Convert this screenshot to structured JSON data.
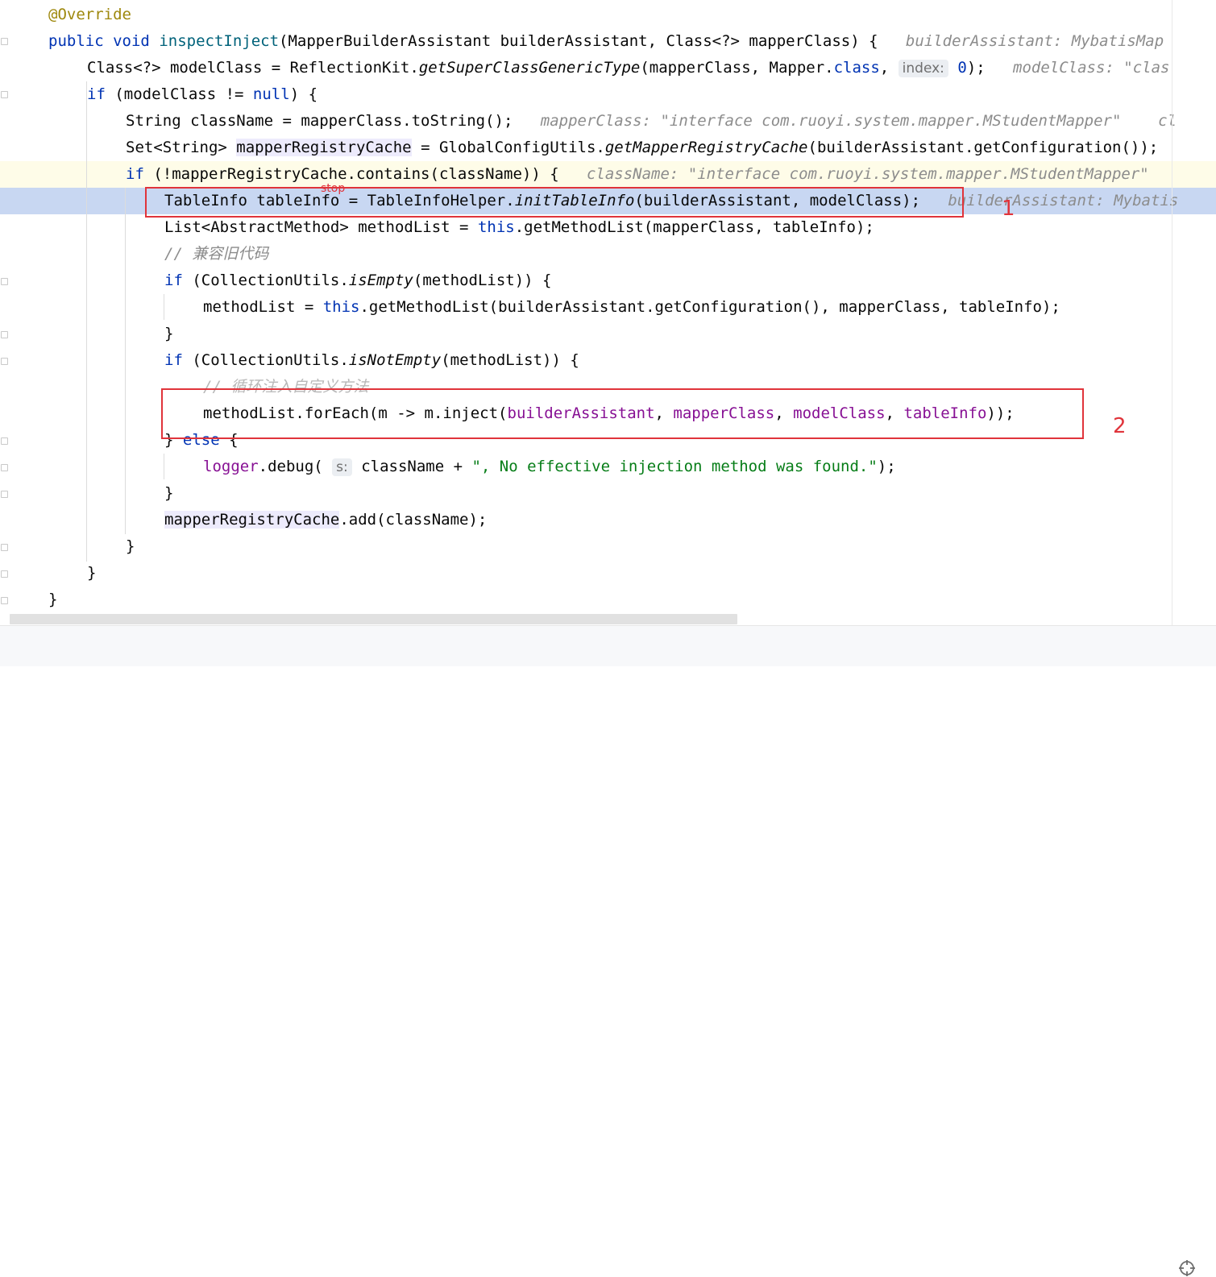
{
  "lines": [
    {
      "segs": [
        {
          "c": "ann",
          "t": "@Override"
        }
      ]
    },
    {
      "segs": [
        {
          "c": "kw",
          "t": "public"
        },
        {
          "t": " "
        },
        {
          "c": "kw",
          "t": "void"
        },
        {
          "t": " "
        },
        {
          "c": "fn",
          "t": "inspectInject"
        },
        {
          "t": "(MapperBuilderAssistant builderAssistant, Class<?> mapperClass) {   "
        },
        {
          "c": "hint",
          "t": "builderAssistant: MybatisMap"
        }
      ]
    },
    {
      "segs": [
        {
          "t": "Class<?> modelClass = ReflectionKit."
        },
        {
          "c": "it",
          "t": "getSuperClassGenericType"
        },
        {
          "t": "(mapperClass, Mapper."
        },
        {
          "c": "kw",
          "t": "class"
        },
        {
          "t": ", "
        },
        {
          "c": "ph",
          "t": "index:"
        },
        {
          "t": " "
        },
        {
          "c": "kw",
          "t": "0"
        },
        {
          "t": ");   "
        },
        {
          "c": "hint",
          "t": "modelClass: \"clas"
        }
      ]
    },
    {
      "segs": [
        {
          "c": "kw",
          "t": "if"
        },
        {
          "t": " (modelClass != "
        },
        {
          "c": "kw",
          "t": "null"
        },
        {
          "t": ") {"
        }
      ]
    },
    {
      "segs": [
        {
          "t": "String className = mapperClass.toString();   "
        },
        {
          "c": "hint",
          "t": "mapperClass: \"interface com.ruoyi.system.mapper.MStudentMapper\"    cl"
        }
      ]
    },
    {
      "segs": [
        {
          "t": "Set<String> "
        },
        {
          "c": "hl",
          "t": "mapperRegistryCache"
        },
        {
          "t": " = GlobalConfigUtils."
        },
        {
          "c": "it",
          "t": "getMapperRegistryCache"
        },
        {
          "t": "(builderAssistant.getConfiguration());"
        }
      ]
    },
    {
      "segs": [
        {
          "c": "kw",
          "t": "if"
        },
        {
          "t": " (!mapperRegistryCache.contains(className)) {   "
        },
        {
          "c": "hint",
          "t": "className: \"interface com.ruoyi.system.mapper.MStudentMapper\""
        }
      ]
    },
    {
      "segs": [
        {
          "t": "TableInfo tableInfo = TableInfoHelper."
        },
        {
          "c": "it",
          "t": "initTableInfo"
        },
        {
          "t": "(builderAssistant, modelClass);   "
        },
        {
          "c": "hint",
          "t": "builderAssistant: Mybatis"
        }
      ]
    },
    {
      "segs": [
        {
          "t": "List<AbstractMethod> methodList = "
        },
        {
          "c": "kw",
          "t": "this"
        },
        {
          "t": ".getMethodList(mapperClass, tableInfo);"
        }
      ]
    },
    {
      "segs": [
        {
          "c": "cm",
          "t": "// 兼容旧代码"
        }
      ]
    },
    {
      "segs": [
        {
          "c": "kw",
          "t": "if"
        },
        {
          "t": " (CollectionUtils."
        },
        {
          "c": "it",
          "t": "isEmpty"
        },
        {
          "t": "(methodList)) {"
        }
      ]
    },
    {
      "segs": [
        {
          "t": "methodList = "
        },
        {
          "c": "kw",
          "t": "this"
        },
        {
          "t": ".getMethodList(builderAssistant.getConfiguration(), mapperClass, tableInfo);"
        }
      ]
    },
    {
      "segs": [
        {
          "t": "}"
        }
      ]
    },
    {
      "segs": [
        {
          "c": "kw",
          "t": "if"
        },
        {
          "t": " (CollectionUtils."
        },
        {
          "c": "it",
          "t": "isNotEmpty"
        },
        {
          "t": "(methodList)) {"
        }
      ]
    },
    {
      "segs": [
        {
          "c": "cmx",
          "t": "// 循环注入自定义方法"
        }
      ]
    },
    {
      "segs": [
        {
          "t": "methodList.forEach(m -> m.inject("
        },
        {
          "c": "pu",
          "t": "builderAssistant"
        },
        {
          "t": ", "
        },
        {
          "c": "pu",
          "t": "mapperClass"
        },
        {
          "t": ", "
        },
        {
          "c": "pu",
          "t": "modelClass"
        },
        {
          "t": ", "
        },
        {
          "c": "pu",
          "t": "tableInfo"
        },
        {
          "t": "));"
        }
      ]
    },
    {
      "segs": [
        {
          "t": "} "
        },
        {
          "c": "kw",
          "t": "else"
        },
        {
          "t": " {"
        }
      ]
    },
    {
      "segs": [
        {
          "c": "pu",
          "t": "logger"
        },
        {
          "t": ".debug( "
        },
        {
          "c": "ph",
          "t": "s:"
        },
        {
          "t": " className + "
        },
        {
          "c": "str",
          "t": "\", No effective injection method was found.\""
        },
        {
          "t": ");"
        }
      ]
    },
    {
      "segs": [
        {
          "t": "}"
        }
      ]
    },
    {
      "segs": [
        {
          "c": "hl",
          "t": "mapperRegistryCache"
        },
        {
          "t": ".add(className);"
        }
      ]
    },
    {
      "segs": [
        {
          "t": "}"
        }
      ]
    },
    {
      "segs": [
        {
          "t": "}"
        }
      ]
    },
    {
      "segs": [
        {
          "t": "}"
        }
      ]
    }
  ],
  "breakpoint_label": "stop",
  "markers": {
    "first": "1",
    "second": "2"
  },
  "icons": {
    "status": "crosshair-icon"
  },
  "colors": {
    "keyword": "#0033b3",
    "annotation": "#9e880d",
    "method": "#00627a",
    "field": "#871094",
    "string": "#067d17",
    "comment": "#8c8c8c",
    "breakpoint_line": "#c8d7f2",
    "current_line": "#fefce8",
    "red_box": "#e0343b"
  }
}
